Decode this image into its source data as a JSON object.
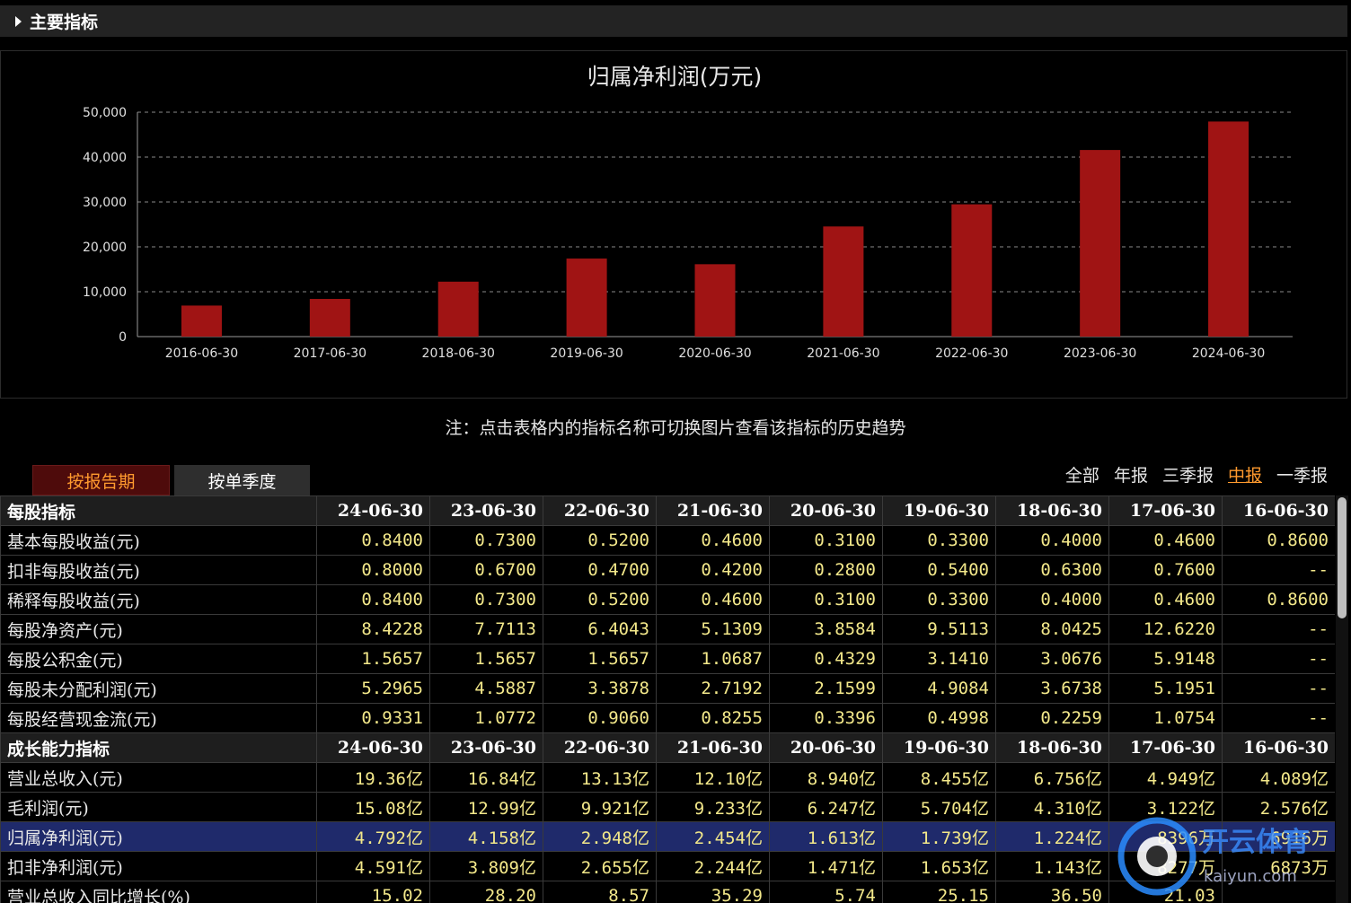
{
  "section": {
    "title": "主要指标"
  },
  "chart_data": {
    "type": "bar",
    "title": "归属净利润(万元)",
    "categories": [
      "2016-06-30",
      "2017-06-30",
      "2018-06-30",
      "2019-06-30",
      "2020-06-30",
      "2021-06-30",
      "2022-06-30",
      "2023-06-30",
      "2024-06-30"
    ],
    "values": [
      6916,
      8397,
      12240,
      17390,
      16130,
      24540,
      29480,
      41580,
      47920
    ],
    "yticks": [
      "0",
      "10,000",
      "20,000",
      "30,000",
      "40,000",
      "50,000"
    ],
    "ylim": [
      0,
      50000
    ],
    "grid": true,
    "bar_color": "#a01414"
  },
  "note": "注：点击表格内的指标名称可切换图片查看该指标的历史趋势",
  "tabs": {
    "period": "按报告期",
    "quarter": "按单季度"
  },
  "filters": {
    "all": "全部",
    "annual": "年报",
    "q3": "三季报",
    "half": "中报",
    "q1": "一季报"
  },
  "table": {
    "rows": [
      {
        "type": "group",
        "cells": [
          "每股指标",
          "24-06-30",
          "23-06-30",
          "22-06-30",
          "21-06-30",
          "20-06-30",
          "19-06-30",
          "18-06-30",
          "17-06-30",
          "16-06-30"
        ]
      },
      {
        "type": "data",
        "cells": [
          "基本每股收益(元)",
          "0.8400",
          "0.7300",
          "0.5200",
          "0.4600",
          "0.3100",
          "0.3300",
          "0.4000",
          "0.4600",
          "0.8600"
        ]
      },
      {
        "type": "data",
        "cells": [
          "扣非每股收益(元)",
          "0.8000",
          "0.6700",
          "0.4700",
          "0.4200",
          "0.2800",
          "0.5400",
          "0.6300",
          "0.7600",
          "--"
        ]
      },
      {
        "type": "data",
        "cells": [
          "稀释每股收益(元)",
          "0.8400",
          "0.7300",
          "0.5200",
          "0.4600",
          "0.3100",
          "0.3300",
          "0.4000",
          "0.4600",
          "0.8600"
        ]
      },
      {
        "type": "data",
        "cells": [
          "每股净资产(元)",
          "8.4228",
          "7.7113",
          "6.4043",
          "5.1309",
          "3.8584",
          "9.5113",
          "8.0425",
          "12.6220",
          "--"
        ]
      },
      {
        "type": "data",
        "cells": [
          "每股公积金(元)",
          "1.5657",
          "1.5657",
          "1.5657",
          "1.0687",
          "0.4329",
          "3.1410",
          "3.0676",
          "5.9148",
          "--"
        ]
      },
      {
        "type": "data",
        "cells": [
          "每股未分配利润(元)",
          "5.2965",
          "4.5887",
          "3.3878",
          "2.7192",
          "2.1599",
          "4.9084",
          "3.6738",
          "5.1951",
          "--"
        ]
      },
      {
        "type": "data",
        "cells": [
          "每股经营现金流(元)",
          "0.9331",
          "1.0772",
          "0.9060",
          "0.8255",
          "0.3396",
          "0.4998",
          "0.2259",
          "1.0754",
          "--"
        ]
      },
      {
        "type": "group",
        "cells": [
          "成长能力指标",
          "24-06-30",
          "23-06-30",
          "22-06-30",
          "21-06-30",
          "20-06-30",
          "19-06-30",
          "18-06-30",
          "17-06-30",
          "16-06-30"
        ]
      },
      {
        "type": "data",
        "cells": [
          "营业总收入(元)",
          "19.36亿",
          "16.84亿",
          "13.13亿",
          "12.10亿",
          "8.940亿",
          "8.455亿",
          "6.756亿",
          "4.949亿",
          "4.089亿"
        ]
      },
      {
        "type": "data",
        "cells": [
          "毛利润(元)",
          "15.08亿",
          "12.99亿",
          "9.921亿",
          "9.233亿",
          "6.247亿",
          "5.704亿",
          "4.310亿",
          "3.122亿",
          "2.576亿"
        ]
      },
      {
        "type": "highlight",
        "cells": [
          "归属净利润(元)",
          "4.792亿",
          "4.158亿",
          "2.948亿",
          "2.454亿",
          "1.613亿",
          "1.739亿",
          "1.224亿",
          "8396万",
          "6916万"
        ]
      },
      {
        "type": "data",
        "cells": [
          "扣非净利润(元)",
          "4.591亿",
          "3.809亿",
          "2.655亿",
          "2.244亿",
          "1.471亿",
          "1.653亿",
          "1.143亿",
          "8277万",
          "6873万"
        ]
      },
      {
        "type": "data",
        "cells": [
          "营业总收入同比增长(%)",
          "15.02",
          "28.20",
          "8.57",
          "35.29",
          "5.74",
          "25.15",
          "36.50",
          "21.03",
          ""
        ]
      }
    ]
  },
  "watermark": {
    "text": "开云体育",
    "sub": "kaiyun.com"
  }
}
